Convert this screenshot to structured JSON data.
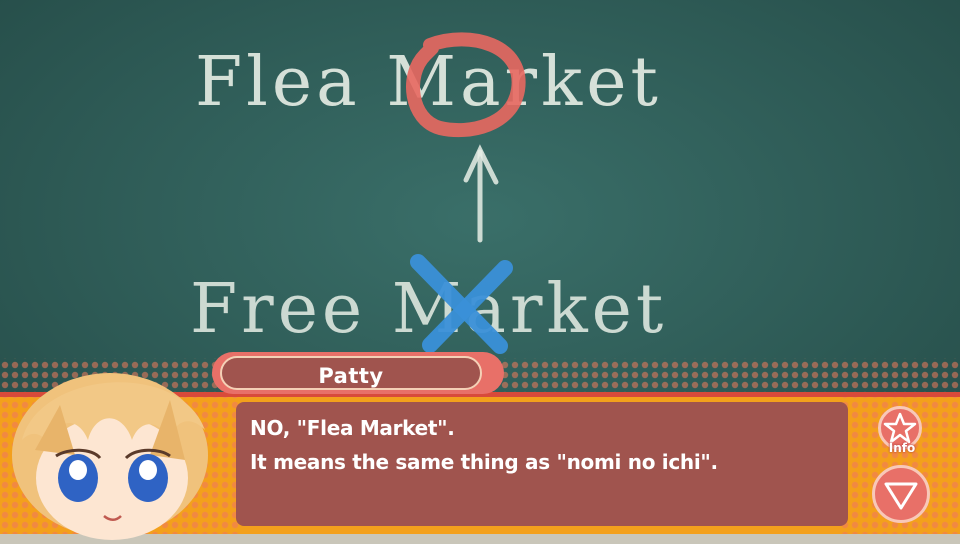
{
  "scene": {
    "board_line_top": "Flea Market",
    "board_line_bottom": "Free Market",
    "board_color": "#2f5f5a",
    "chalk_color": "#e8eee6",
    "circle_color": "#e86860",
    "cross_color": "#3a90d8"
  },
  "dialog": {
    "speaker": "Patty",
    "lines": [
      "NO, \"Flea Market\".",
      "It means the same thing as \"nomi no ichi\"."
    ],
    "info_label": "Info",
    "panel_color": "#f3a01c",
    "text_box_color": "#a0544e"
  },
  "icons": {
    "info": "star-icon",
    "advance": "down-triangle-icon"
  }
}
